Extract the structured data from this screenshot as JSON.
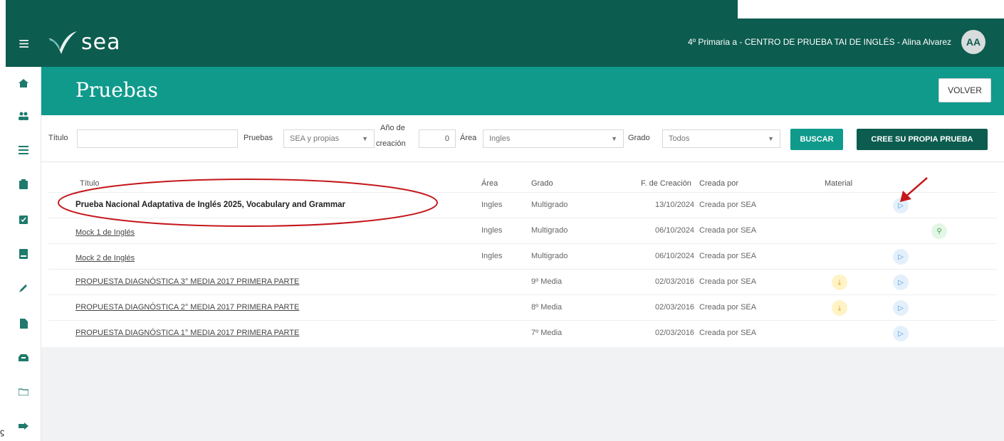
{
  "header": {
    "app_name": "sea",
    "user_info": "4º Primaria a - CENTRO DE PRUEBA TAI DE INGLÉS - Alina Alvarez",
    "avatar_initials": "AA",
    "ghost_user_info": "4º Primaria a - CENTRO DE PRUEBA TAI DE INGLÉS - Alina Alvarez",
    "brand_color": "#0c5c4f",
    "accent_color": "#0f9a8c"
  },
  "sidebar": {
    "items": [
      {
        "icon": "home-icon"
      },
      {
        "icon": "users-icon"
      },
      {
        "icon": "list-icon"
      },
      {
        "icon": "clipboard-icon"
      },
      {
        "icon": "checkbox-icon"
      },
      {
        "icon": "book-icon"
      },
      {
        "icon": "pencil-icon"
      },
      {
        "icon": "document-icon"
      },
      {
        "icon": "inbox-icon"
      },
      {
        "icon": "folder-share-icon"
      },
      {
        "icon": "logout-icon"
      }
    ]
  },
  "page": {
    "title": "Pruebas",
    "back_label": "VOLVER"
  },
  "filters": {
    "title_label": "Título",
    "title_value": "",
    "tests_label": "Pruebas",
    "tests_value": "SEA y propias",
    "year_label_1": "Año de",
    "year_label_2": "creación",
    "year_value": "0",
    "area_label": "Área",
    "area_value": "Ingles",
    "grade_label": "Grado",
    "grade_value": "Todos",
    "search_label": "BUSCAR",
    "create_label": "CREE SU PROPIA PRUEBA"
  },
  "table": {
    "headers": {
      "title": "Título",
      "area": "Área",
      "grade": "Grado",
      "date": "F. de Creación",
      "creator": "Creada por",
      "material": "Material"
    },
    "rows": [
      {
        "title": "Prueba Nacional Adaptativa de Inglés 2025, Vocabulary and Grammar",
        "area": "Ingles",
        "grade": "Multigrado",
        "date": "13/10/2024",
        "creator": "Creada por SEA",
        "material": "",
        "action": "play"
      },
      {
        "title": "Mock 1 de Inglés",
        "area": "Ingles",
        "grade": "Multigrado",
        "date": "06/10/2024",
        "creator": "Creada por SEA",
        "material": "",
        "action": "search"
      },
      {
        "title": "Mock 2 de Inglés",
        "area": "Ingles",
        "grade": "Multigrado",
        "date": "06/10/2024",
        "creator": "Creada por SEA",
        "material": "",
        "action": "play"
      },
      {
        "title": "PROPUESTA DIAGNÓSTICA 3° MEDIA 2017 PRIMERA PARTE",
        "area": "",
        "grade": "9º Media",
        "date": "02/03/2016",
        "creator": "Creada por SEA",
        "material": "download",
        "action": "play"
      },
      {
        "title": "PROPUESTA DIAGNÓSTICA 2° MEDIA 2017 PRIMERA PARTE",
        "area": "",
        "grade": "8º Media",
        "date": "02/03/2016",
        "creator": "Creada por SEA",
        "material": "download",
        "action": "play"
      },
      {
        "title": "PROPUESTA DIAGNÓSTICA 1° MEDIA 2017 PRIMERA PARTE",
        "area": "",
        "grade": "7º Media",
        "date": "02/03/2016",
        "creator": "Creada por SEA",
        "material": "",
        "action": "play"
      }
    ]
  },
  "stray_char": "ϛ"
}
